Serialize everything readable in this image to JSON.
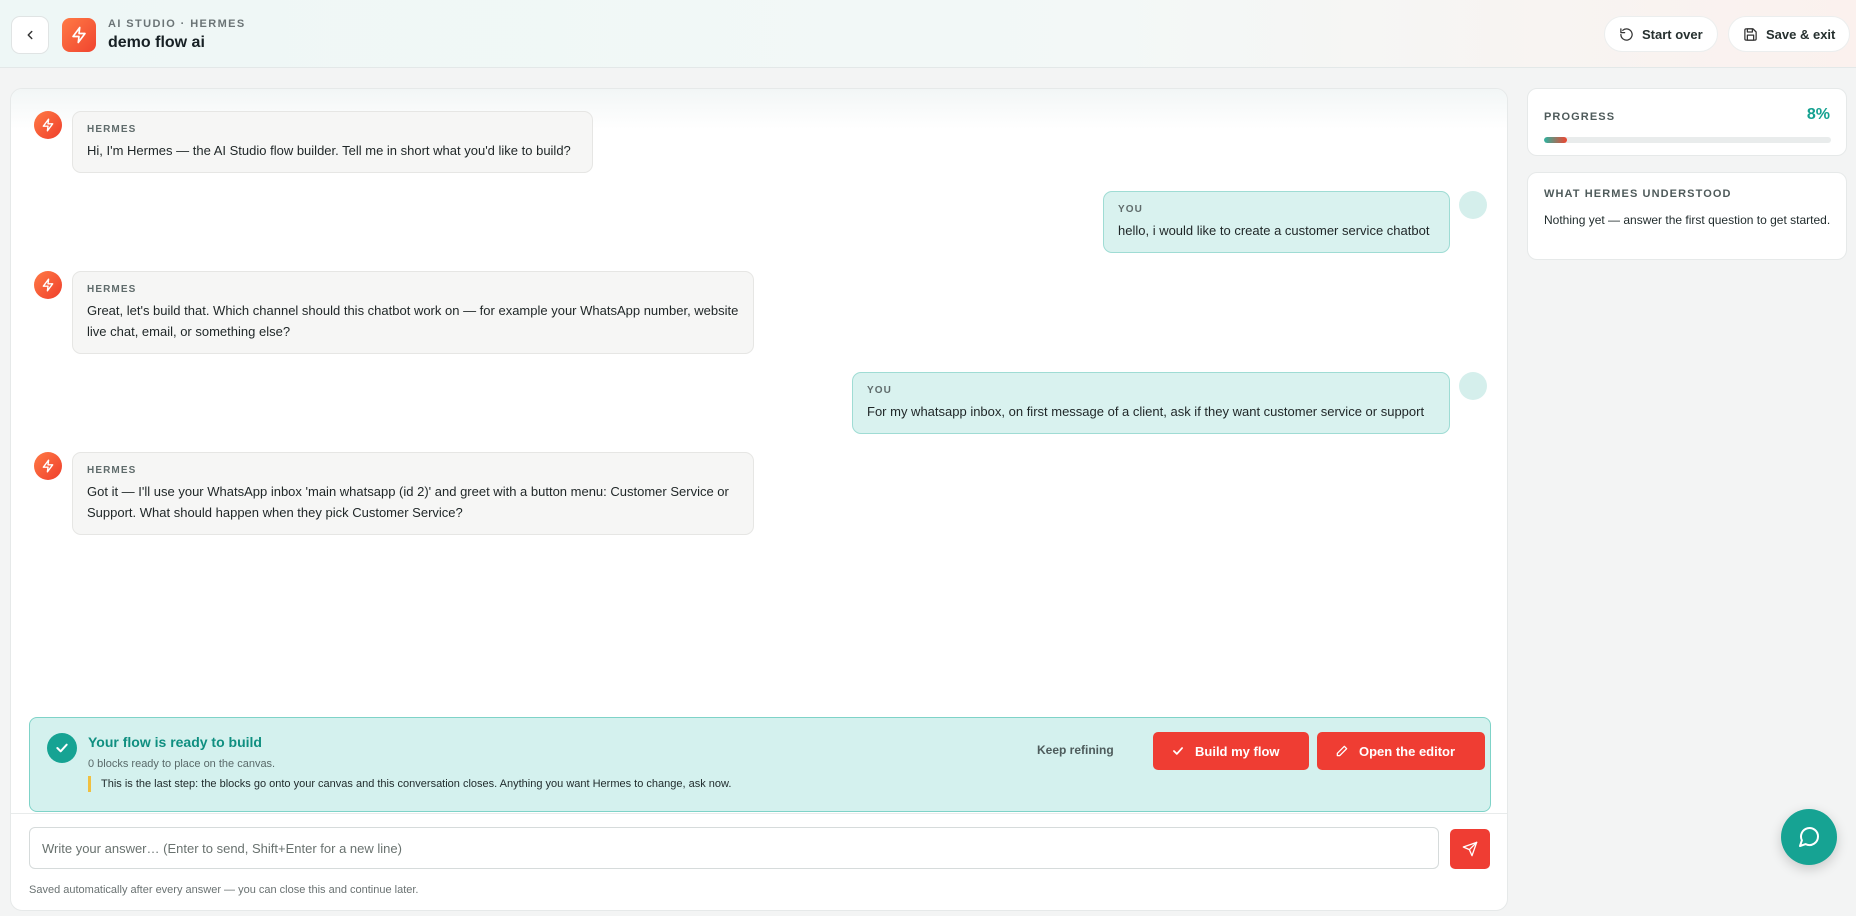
{
  "header": {
    "subtitle": "AI STUDIO · HERMES",
    "title": "demo flow ai",
    "start_over": "Start over",
    "save_exit": "Save & exit"
  },
  "messages": [
    {
      "from": "bot",
      "who": "HERMES",
      "text": "Hi, I'm Hermes — the AI Studio flow builder. Tell me in short what you'd like to build?"
    },
    {
      "from": "user",
      "who": "YOU",
      "text": "hello, i would like to create a customer service chatbot"
    },
    {
      "from": "bot",
      "who": "HERMES",
      "text": "Great, let's build that. Which channel should this chatbot work on — for example your WhatsApp number, website live chat, email, or something else?"
    },
    {
      "from": "user",
      "who": "YOU",
      "text": "For my whatsapp inbox, on first message of a client, ask if they want customer service or support"
    },
    {
      "from": "bot",
      "who": "HERMES",
      "text": "Got it — I'll use your WhatsApp inbox 'main whatsapp (id 2)' and greet with a button menu: Customer Service or Support. What should happen when they pick Customer Service?"
    }
  ],
  "ready": {
    "title": "Your flow is ready to build",
    "subtitle": "0 blocks ready to place on the canvas.",
    "note": "This is the last step: the blocks go onto your canvas and this conversation closes. Anything you want Hermes to change, ask now.",
    "keep_refining": "Keep refining",
    "build": "Build my flow",
    "open_editor": "Open the editor"
  },
  "composer": {
    "placeholder": "Write your answer… (Enter to send, Shift+Enter for a new line)",
    "saved_note": "Saved automatically after every answer — you can close this and continue later."
  },
  "sidebar": {
    "progress_label": "PROGRESS",
    "progress_value": "8%",
    "progress_fraction": 0.08,
    "understood_label": "WHAT HERMES UNDERSTOOD",
    "understood_text": "Nothing yet — answer the first question to get started."
  },
  "colors": {
    "accent_teal": "#16a393",
    "accent_red": "#ef3d33"
  }
}
